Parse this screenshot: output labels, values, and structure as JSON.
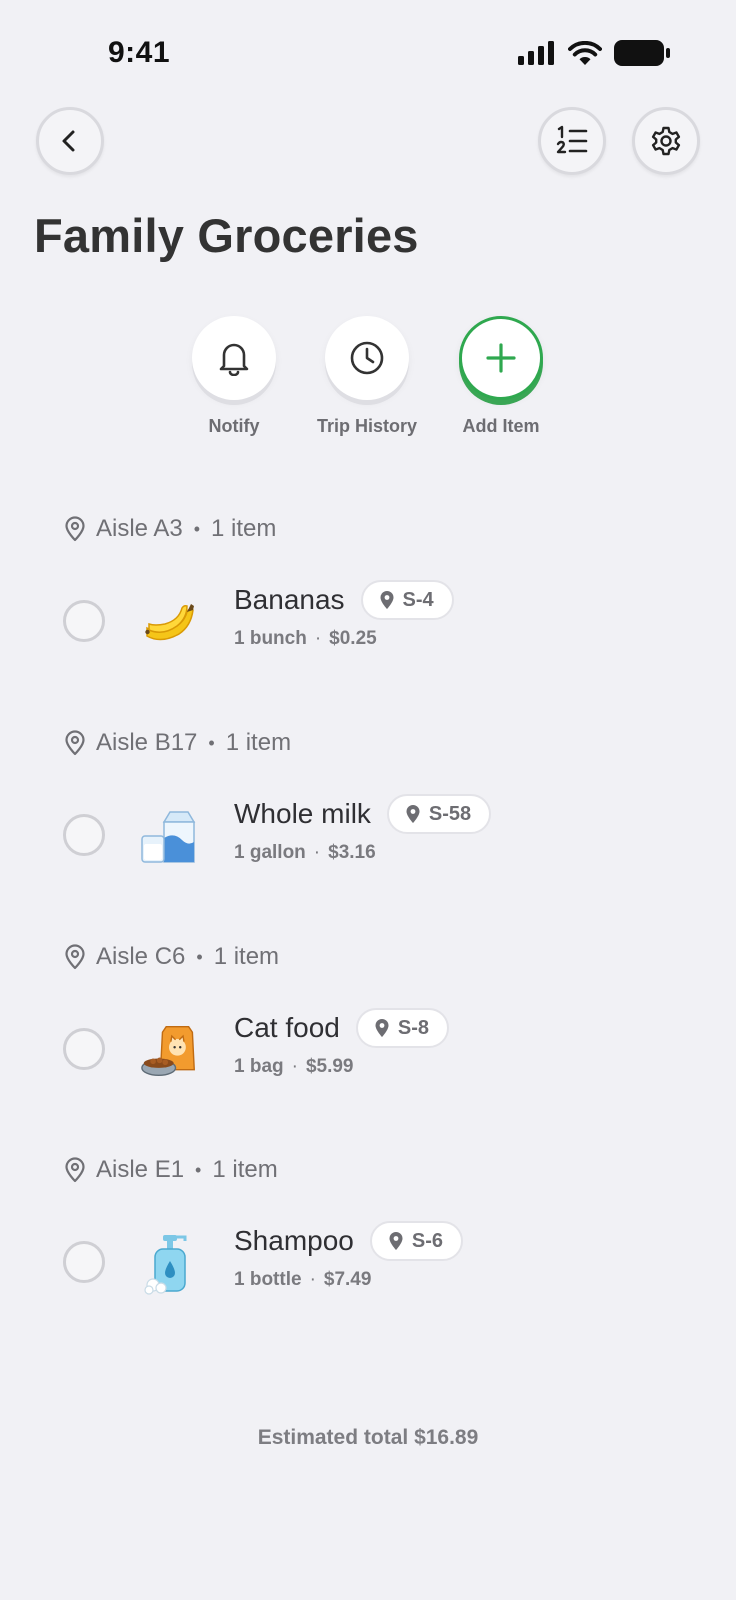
{
  "status_bar": {
    "time": "9:41"
  },
  "header": {
    "title": "Family Groceries"
  },
  "actions": [
    {
      "label": "Notify",
      "icon": "bell-icon"
    },
    {
      "label": "Trip History",
      "icon": "clock-icon"
    },
    {
      "label": "Add Item",
      "icon": "plus-icon"
    }
  ],
  "aisles": [
    {
      "aisle": "Aisle A3",
      "count": "1 item",
      "item": {
        "name": "Bananas",
        "shelf": "S-4",
        "qty": "1 bunch",
        "price": "$0.25",
        "icon": "banana"
      }
    },
    {
      "aisle": "Aisle B17",
      "count": "1 item",
      "item": {
        "name": "Whole milk",
        "shelf": "S-58",
        "qty": "1 gallon",
        "price": "$3.16",
        "icon": "milk-carton"
      }
    },
    {
      "aisle": "Aisle C6",
      "count": "1 item",
      "item": {
        "name": "Cat food",
        "shelf": "S-8",
        "qty": "1 bag",
        "price": "$5.99",
        "icon": "cat-food"
      }
    },
    {
      "aisle": "Aisle E1",
      "count": "1 item",
      "item": {
        "name": "Shampoo",
        "shelf": "S-6",
        "qty": "1 bottle",
        "price": "$7.49",
        "icon": "shampoo-bottle"
      }
    }
  ],
  "footer": {
    "total_label": "Estimated total",
    "total_value": "$16.89"
  },
  "colors": {
    "background": "#f1f1f5",
    "accent_green": "#2fa84f",
    "text_primary": "#333333",
    "text_secondary": "#707075"
  }
}
